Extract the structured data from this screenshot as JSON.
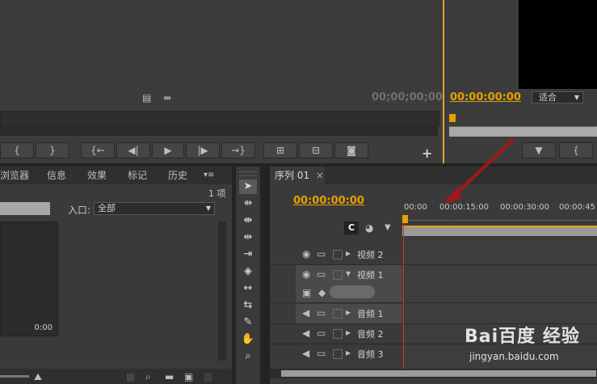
{
  "source_monitor": {
    "timecode": "00;00;00;00",
    "transport": [
      "{",
      "}",
      "{←",
      "◀|",
      "▶",
      "|▶",
      "→}",
      "⊞",
      "⊟",
      "camera"
    ],
    "add_label": "+"
  },
  "program_monitor": {
    "timecode": "00:00:00:00",
    "fit_label": "适合",
    "buttons": [
      "▼",
      "{"
    ]
  },
  "project_panel": {
    "tabs": [
      "浏览器",
      "信息",
      "效果",
      "标记",
      "历史"
    ],
    "menu_icon": "▾≡",
    "item_count": "1 项",
    "inpoint_label": "入口:",
    "inpoint_value": "全部",
    "thumb_duration": "0:00"
  },
  "tools": [
    "select-tool-icon",
    "track-select-icon",
    "ripple-edit-icon",
    "rolling-edit-icon",
    "rate-stretch-icon",
    "razor-icon",
    "slip-icon",
    "slide-icon",
    "pen-icon",
    "hand-icon",
    "zoom-icon"
  ],
  "timeline": {
    "tab_label": "序列 01",
    "close_label": "×",
    "timecode": "00:00:00:00",
    "ruler": [
      "00:00",
      "00:00:15:00",
      "00:00:30:00",
      "00:00:45"
    ],
    "tracks": [
      {
        "name": "视频 2",
        "kind": "video"
      },
      {
        "name": "视频 1",
        "kind": "video"
      },
      {
        "name": "音频 1",
        "kind": "audio"
      },
      {
        "name": "音频 2",
        "kind": "audio"
      },
      {
        "name": "音频 3",
        "kind": "audio"
      }
    ]
  },
  "watermark": {
    "brand": "Bai百度 经验",
    "url": "jingyan.baidu.com"
  },
  "colors": {
    "accent": "#e6a000",
    "arrow": "#a01818",
    "playhead": "#d03030"
  }
}
